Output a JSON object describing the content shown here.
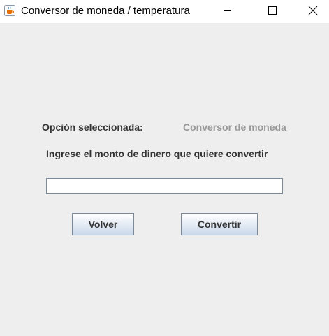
{
  "window": {
    "title": "Conversor de moneda / temperatura",
    "controls": {
      "minimize": "minimize-icon",
      "maximize": "maximize-icon",
      "close": "close-icon"
    },
    "icon": "java-cup-icon"
  },
  "form": {
    "option_label": "Opción seleccionada:",
    "option_value": "Conversor de moneda",
    "prompt": "Ingrese el monto de dinero que quiere convertir",
    "amount_value": "",
    "back_button": "Volver",
    "convert_button": "Convertir"
  },
  "colors": {
    "background": "#eeeeee",
    "label": "#333333",
    "disabled_label": "#999999",
    "button_border": "#7a8a99"
  }
}
